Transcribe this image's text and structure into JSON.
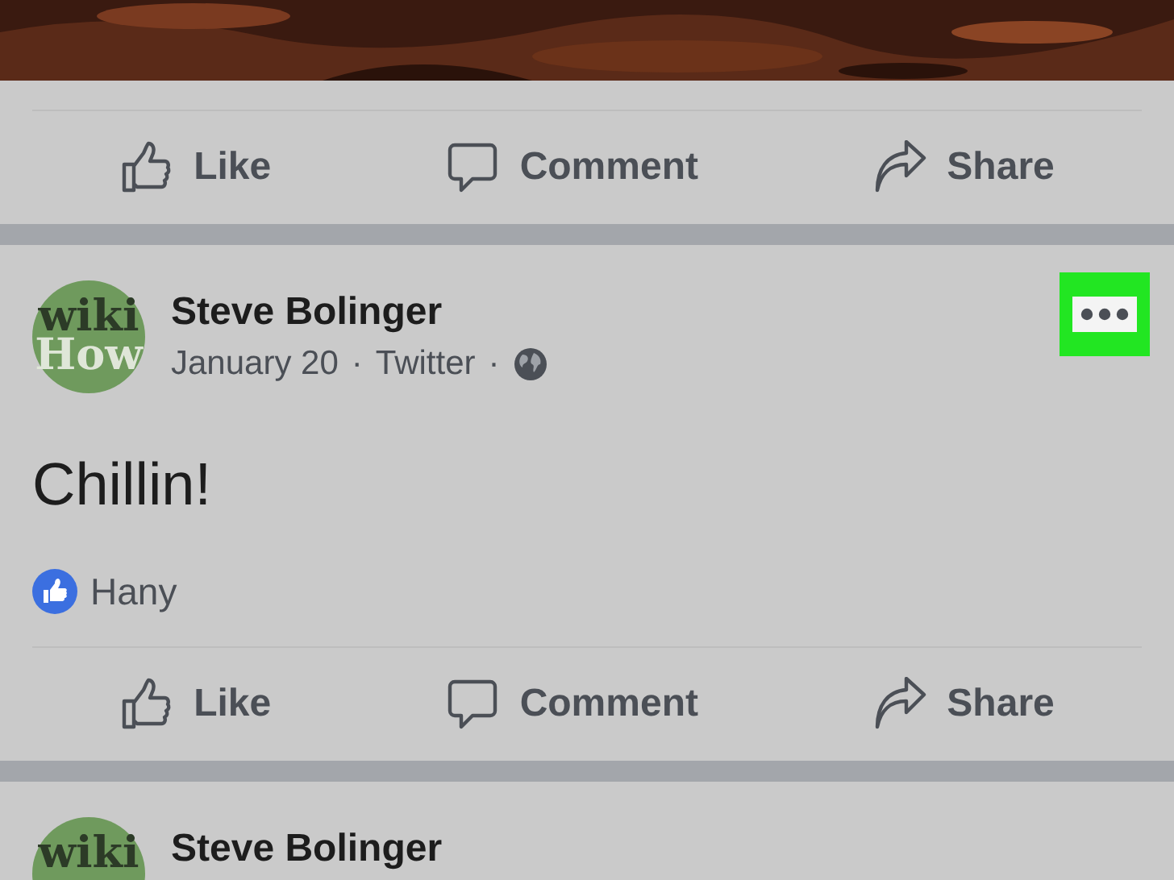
{
  "top_post": {
    "actions": [
      {
        "kind": "like",
        "label": "Like"
      },
      {
        "kind": "comment",
        "label": "Comment"
      },
      {
        "kind": "share",
        "label": "Share"
      }
    ]
  },
  "post": {
    "avatar": [
      "wiki",
      "How"
    ],
    "author": "Steve Bolinger",
    "date": "January 20",
    "source": "Twitter",
    "separator": "·",
    "public": true,
    "more_button": {
      "highlighted": true
    },
    "text": "Chillin!",
    "reactions": {
      "kind": "like",
      "names": "Hany"
    },
    "actions": [
      {
        "kind": "like",
        "label": "Like"
      },
      {
        "kind": "comment",
        "label": "Comment"
      },
      {
        "kind": "share",
        "label": "Share"
      }
    ]
  },
  "next_post": {
    "avatar": [
      "wiki"
    ],
    "author": "Steve Bolinger"
  }
}
